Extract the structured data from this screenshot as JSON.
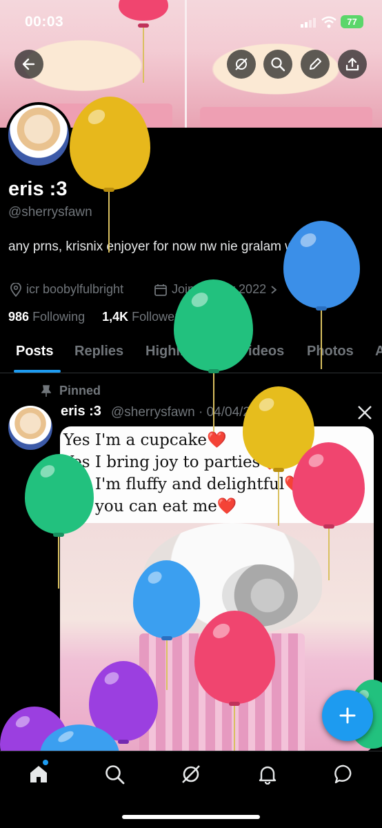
{
  "status": {
    "time": "00:03",
    "battery": "77"
  },
  "profile": {
    "name": "eris :3",
    "handle": "@sherrysfawn",
    "bio": "any prns, krisnix enjoyer for now nw nie gralam w apollo 🪼",
    "location": "icr boobylfulbright",
    "joined": "Joined May 2022",
    "following_count": "986",
    "following_label": "Following",
    "followers_count": "1,4K",
    "followers_label": "Followers"
  },
  "tabs": [
    "Posts",
    "Replies",
    "Highlights",
    "Videos",
    "Photos",
    "A"
  ],
  "post": {
    "pinned_label": "Pinned",
    "author": "eris :3",
    "handle_date": "@sherrysfawn · 04/04/2026",
    "lines": [
      "Yes I'm a cupcake❤️",
      "Yes I bring joy to parties❤️",
      "Yes I'm fluffy and delightful❤️",
      "Yes you can eat me❤️"
    ]
  },
  "icons": {
    "back": "back-arrow-icon",
    "grok": "grok-icon",
    "search": "search-icon",
    "edit": "pencil-icon",
    "share": "share-icon",
    "x_logo": "x-logo-icon",
    "compose": "plus-icon",
    "nav": [
      "home-icon",
      "search-icon",
      "grok-icon",
      "bell-icon",
      "messages-icon"
    ]
  },
  "colors": {
    "accent": "#1d9bf0",
    "background": "#000000",
    "muted": "#71767b"
  }
}
